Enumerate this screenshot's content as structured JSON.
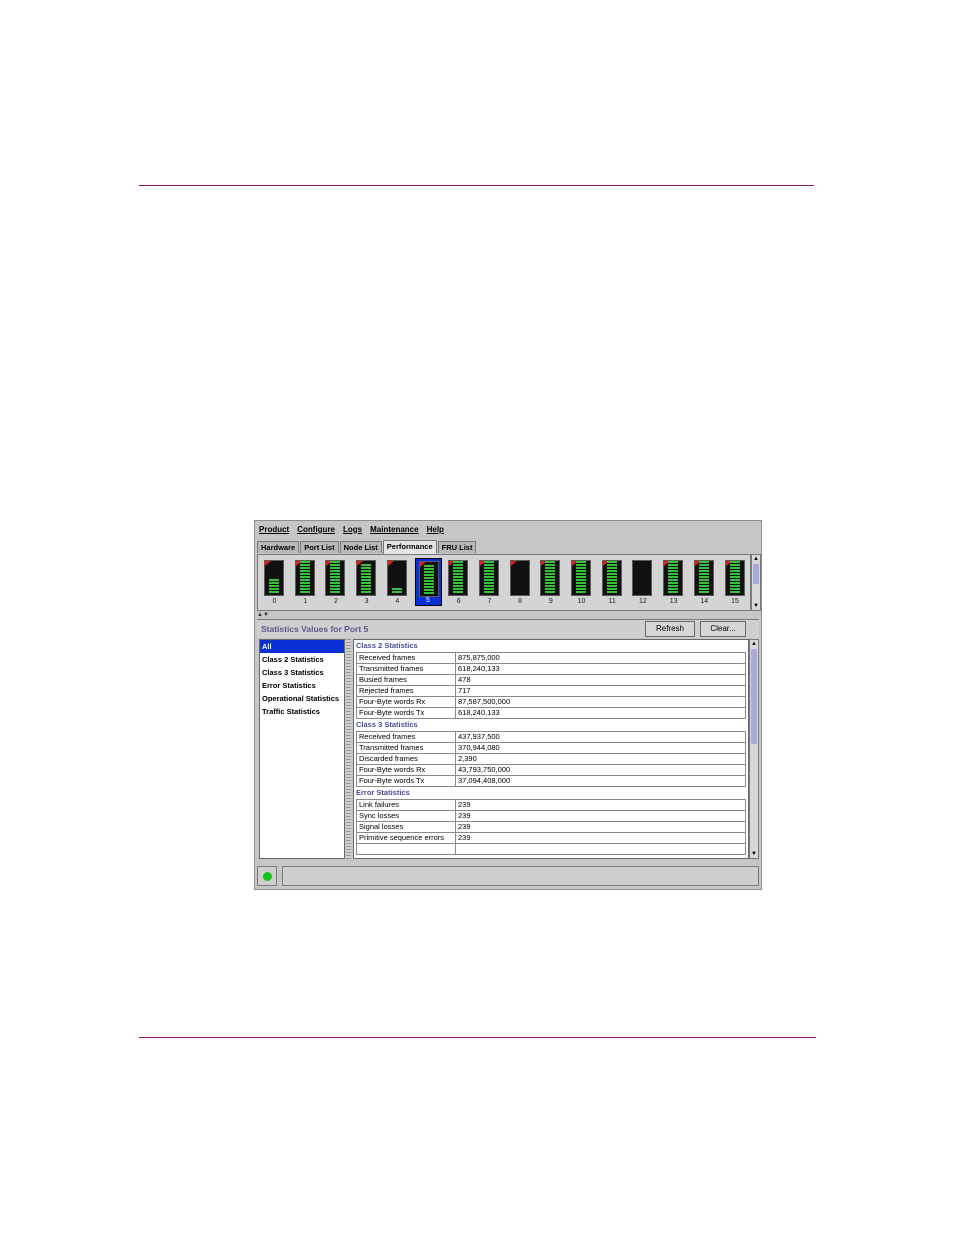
{
  "menu": [
    "Product",
    "Configure",
    "Logs",
    "Maintenance",
    "Help"
  ],
  "tabs": [
    "Hardware",
    "Port List",
    "Node List",
    "Performance",
    "FRU List"
  ],
  "active_tab": "Performance",
  "ports": [
    {
      "num": "0",
      "level": 5,
      "flag": true
    },
    {
      "num": "1",
      "level": 11,
      "flag": true
    },
    {
      "num": "2",
      "level": 11,
      "flag": true
    },
    {
      "num": "3",
      "level": 10,
      "flag": true
    },
    {
      "num": "4",
      "level": 2,
      "flag": true
    },
    {
      "num": "5",
      "level": 10,
      "flag": true,
      "selected": true
    },
    {
      "num": "6",
      "level": 11,
      "flag": true
    },
    {
      "num": "7",
      "level": 11,
      "flag": true
    },
    {
      "num": "8",
      "level": 0,
      "flag": true
    },
    {
      "num": "9",
      "level": 11,
      "flag": true
    },
    {
      "num": "10",
      "level": 11,
      "flag": true
    },
    {
      "num": "11",
      "level": 11,
      "flag": true
    },
    {
      "num": "12",
      "level": 0,
      "flag": false
    },
    {
      "num": "13",
      "level": 11,
      "flag": true
    },
    {
      "num": "14",
      "level": 11,
      "flag": true
    },
    {
      "num": "15",
      "level": 11,
      "flag": true
    }
  ],
  "stats": {
    "title": "Statistics Values for Port 5",
    "refresh_label": "Refresh",
    "clear_label": "Clear..."
  },
  "categories": [
    "All",
    "Class 2 Statistics",
    "Class 3 Statistics",
    "Error Statistics",
    "Operational Statistics",
    "Traffic Statistics"
  ],
  "selected_category": "All",
  "sections": [
    {
      "title": "Class 2 Statistics",
      "rows": [
        [
          "Received frames",
          "875,875,000"
        ],
        [
          "Transmitted frames",
          "618,240,133"
        ],
        [
          "Busied frames",
          "478"
        ],
        [
          "Rejected frames",
          "717"
        ],
        [
          "Four-Byte words Rx",
          "87,587,500,000"
        ],
        [
          "Four-Byte words Tx",
          "618,240,133"
        ]
      ]
    },
    {
      "title": "Class 3 Statistics",
      "rows": [
        [
          "Received frames",
          "437,937,500"
        ],
        [
          "Transmitted frames",
          "370,944,080"
        ],
        [
          "Discarded frames",
          "2,390"
        ],
        [
          "Four-Byte words Rx",
          "43,793,750,000"
        ],
        [
          "Four-Byte words Tx",
          "37,094,408,000"
        ]
      ]
    },
    {
      "title": "Error Statistics",
      "rows": [
        [
          "Link failures",
          "239"
        ],
        [
          "Sync losses",
          "239"
        ],
        [
          "Signal losses",
          "239"
        ],
        [
          "Primitive sequence errors",
          "239"
        ],
        [
          "",
          ""
        ]
      ]
    }
  ],
  "colors": {
    "rule": "#8b1a6b",
    "selection": "#0b2fd6",
    "led": "#16c016",
    "bar": "#38c038",
    "flag": "#e01b1b"
  }
}
